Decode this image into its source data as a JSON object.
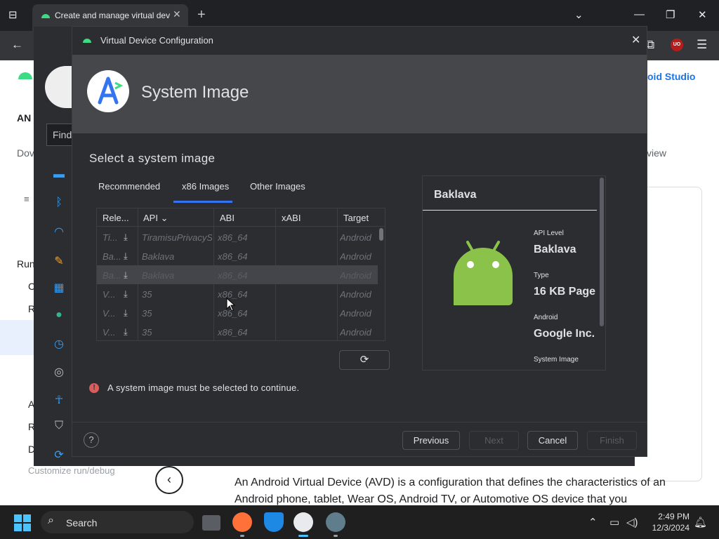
{
  "browser": {
    "tab_title": "Create and manage virtual dev",
    "tab_close": "✕",
    "new_tab": "+",
    "minimize": "—",
    "restore": "❐",
    "close": "✕",
    "ublock_label": "UO"
  },
  "page": {
    "brand_link": "oid Studio",
    "view_link": "view",
    "left_heading": "AN",
    "left_dov": "Dov",
    "find_label": "Find",
    "run_label": "Run",
    "customize_label": "Customize run/debug",
    "body_text": "An Android Virtual Device (AVD) is a configuration that defines the characteristics of an Android phone, tablet, Wear OS, Android TV, or Automotive OS device that you",
    "prev_arrow": "‹",
    "sidebar_letters": [
      "C",
      "R",
      "A",
      "R",
      "D"
    ]
  },
  "dialog": {
    "title": "Virtual Device Configuration",
    "close": "✕",
    "header_title": "System Image",
    "section_title": "Select a system image",
    "tabs": [
      "Recommended",
      "x86 Images",
      "Other Images"
    ],
    "active_tab": "x86 Images",
    "table": {
      "columns": [
        "Rele...",
        "API ⌄",
        "ABI",
        "xABI",
        "Target"
      ],
      "rows": [
        {
          "release": "Ti...",
          "api": "TiramisuPrivacySandbox",
          "abi": "x86_64",
          "xabi": "",
          "target": "Android"
        },
        {
          "release": "Ba...",
          "api": "Baklava",
          "abi": "x86_64",
          "xabi": "",
          "target": "Android"
        },
        {
          "release": "Ba...",
          "api": "Baklava",
          "abi": "x86_64",
          "xabi": "",
          "target": "Android",
          "selected": true
        },
        {
          "release": "V...",
          "api": "35",
          "abi": "x86_64",
          "xabi": "",
          "target": "Android"
        },
        {
          "release": "V...",
          "api": "35",
          "abi": "x86_64",
          "xabi": "",
          "target": "Android"
        },
        {
          "release": "V...",
          "api": "35",
          "abi": "x86_64",
          "xabi": "",
          "target": "Android"
        }
      ]
    },
    "refresh_glyph": "⟳",
    "detail": {
      "title": "Baklava",
      "api_level_label": "API Level",
      "api_level_value": "Baklava",
      "type_label": "Type",
      "type_value": "16 KB Page",
      "vendor_label": "Android",
      "vendor_value": "Google Inc.",
      "system_image_label": "System Image"
    },
    "error": {
      "icon": "!",
      "text": "A system image must be selected to continue."
    },
    "footer": {
      "help": "?",
      "previous": "Previous",
      "next": "Next",
      "cancel": "Cancel",
      "finish": "Finish"
    }
  },
  "taskbar": {
    "search_label": "Search",
    "time": "2:49 PM",
    "date": "12/3/2024"
  },
  "colors": {
    "accent": "#3574f0",
    "android_green": "#8bc34a",
    "error": "#db5c5c"
  }
}
